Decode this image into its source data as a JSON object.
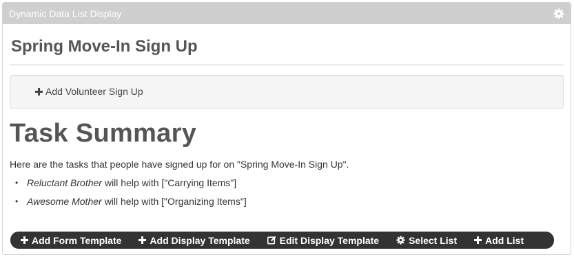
{
  "panel": {
    "title": "Dynamic Data List Display",
    "settings_icon": "gear-icon"
  },
  "page": {
    "title": "Spring Move-In Sign Up",
    "add_signup_label": "Add Volunteer Sign Up",
    "add_signup_icon": "plus-icon"
  },
  "summary": {
    "title": "Task Summary",
    "intro": "Here are the tasks that people have signed up for on \"Spring Move-In Sign Up\".",
    "tasks": [
      {
        "person": "Reluctant Brother",
        "text": "will help with [\"Carrying Items\"]"
      },
      {
        "person": "Awesome Mother",
        "text": "will help with [\"Organizing Items\"]"
      }
    ]
  },
  "toolbar": {
    "buttons": [
      {
        "label": "Add Form Template",
        "icon": "plus-icon"
      },
      {
        "label": "Add Display Template",
        "icon": "plus-icon"
      },
      {
        "label": "Edit Display Template",
        "icon": "edit-icon"
      },
      {
        "label": "Select List",
        "icon": "gear-icon"
      },
      {
        "label": "Add List",
        "icon": "plus-icon"
      }
    ]
  },
  "colors": {
    "header_bg": "#cfcfcf",
    "toolbar_bg": "#333333",
    "heading_text": "#555555",
    "well_bg": "#f5f5f5"
  }
}
